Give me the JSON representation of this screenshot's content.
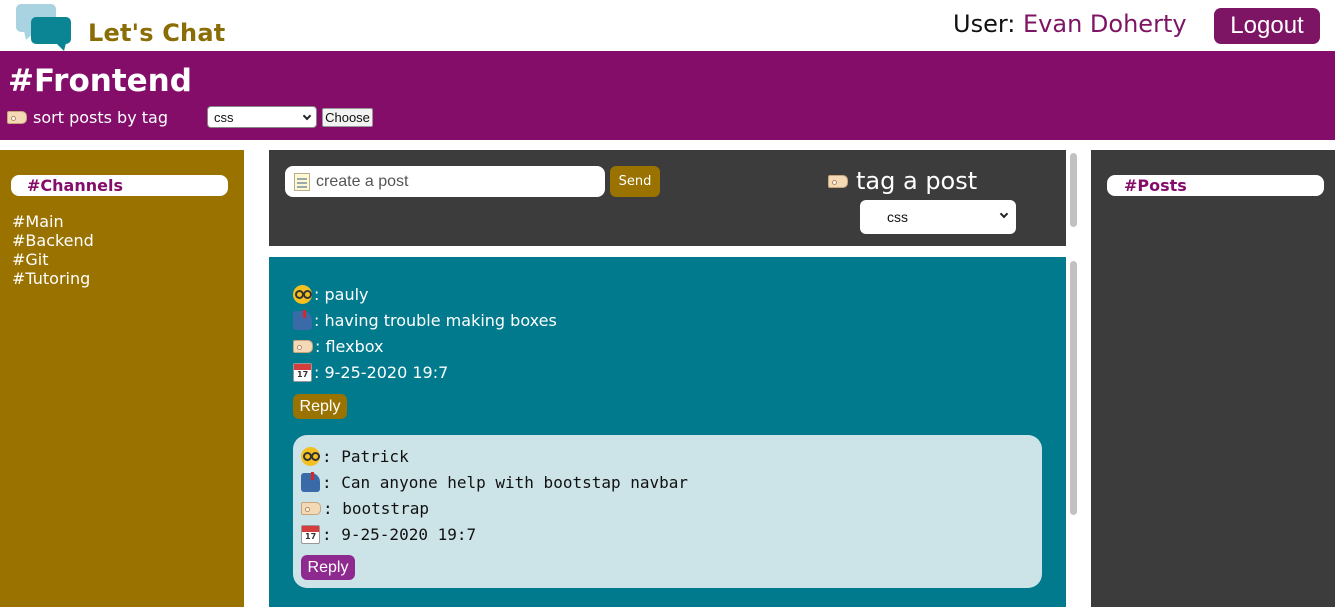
{
  "header": {
    "app_title": "Let's Chat",
    "user_label": "User:",
    "user_name": "Evan Doherty",
    "logout_label": "Logout"
  },
  "channel": {
    "title": "#Frontend",
    "sort_label": "sort posts by tag",
    "sort_selected": "css",
    "choose_label": "Choose"
  },
  "sidebar": {
    "heading": "#Channels",
    "items": [
      "#Main",
      "#Backend",
      "#Git",
      "#Tutoring"
    ]
  },
  "composer": {
    "placeholder": "create a post",
    "send_label": "Send",
    "tag_label": "tag a post",
    "tag_selected": "css"
  },
  "posts": [
    {
      "author": ": pauly",
      "message": ": having trouble making boxes",
      "tag": ": flexbox",
      "date": ": 9-25-2020 19:7",
      "reply_label": "Reply"
    },
    {
      "author": ": Patrick",
      "message": ": Can anyone help with bootstap navbar",
      "tag": ": bootstrap",
      "date": ": 9-25-2020 19:7",
      "reply_label": "Reply"
    }
  ],
  "right_sidebar": {
    "heading": "#Posts"
  },
  "icons": {
    "logo": "chat-bubbles-icon",
    "tag": "label-tag-icon",
    "memo": "memo-icon",
    "author": "nerd-face-icon",
    "message": "mailbox-icon",
    "date": "calendar-icon"
  },
  "colors": {
    "brand_purple": "#840d6a",
    "gold": "#9a7200",
    "teal": "#017a8d",
    "dark": "#3c3c3c",
    "reply_card": "#cce3e7"
  }
}
